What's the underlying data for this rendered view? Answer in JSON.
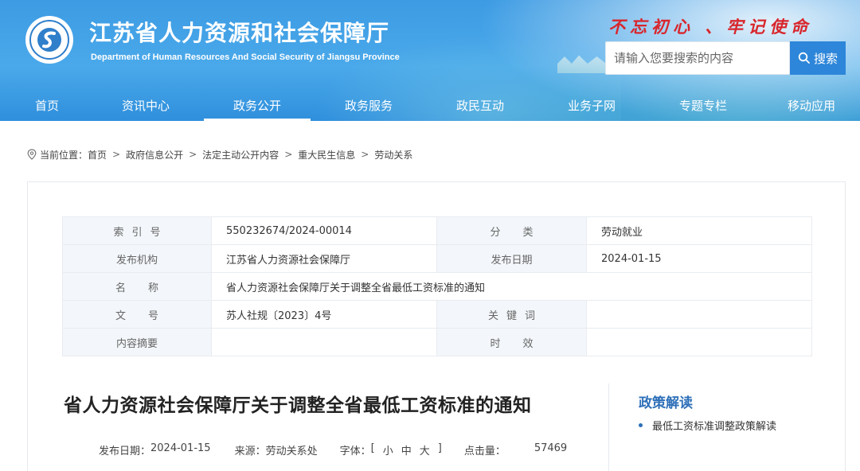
{
  "header": {
    "site_title": "江苏省人力资源和社会保障厅",
    "site_title_en": "Department of Human Resources And Social Security of Jiangsu Province",
    "slogan": "不忘初心 、牢记使命",
    "logo_icon": "jiangsu-hrss-emblem-icon"
  },
  "search": {
    "placeholder": "请输入您要搜索的内容",
    "button_label": "搜索",
    "icon": "search-icon"
  },
  "nav": {
    "items": [
      {
        "label": "首页"
      },
      {
        "label": "资讯中心"
      },
      {
        "label": "政务公开"
      },
      {
        "label": "政务服务"
      },
      {
        "label": "政民互动"
      },
      {
        "label": "业务子网"
      },
      {
        "label": "专题专栏"
      },
      {
        "label": "移动应用"
      }
    ],
    "active": "政务公开"
  },
  "breadcrumb": {
    "prefix": "当前位置：",
    "items": [
      "首页",
      "政府信息公开",
      "法定主动公开内容",
      "重大民生信息",
      "劳动关系"
    ],
    "separator": ">"
  },
  "meta": {
    "index_label": "索引号",
    "index_value": "550232674/2024-00014",
    "category_label": "分类",
    "category_value": "劳动就业",
    "publisher_label": "发布机构",
    "publisher_value": "江苏省人力资源社会保障厅",
    "pubdate_label": "发布日期",
    "pubdate_value": "2024-01-15",
    "name_label": "名称",
    "name_value": "省人力资源社会保障厅关于调整全省最低工资标准的通知",
    "docno_label": "文号",
    "docno_value": "苏人社规〔2023〕4号",
    "keywords_label": "关键词",
    "keywords_value": "",
    "summary_label": "内容摘要",
    "summary_value": "",
    "validity_label": "时效",
    "validity_value": ""
  },
  "article": {
    "title": "省人力资源社会保障厅关于调整全省最低工资标准的通知",
    "date_label": "发布日期：",
    "date_value": "2024-01-15",
    "source_label": "来源：",
    "source_value": "劳动关系处",
    "font_label": "字体：",
    "font_open": "[",
    "font_small": "小",
    "font_medium": "中",
    "font_large": "大",
    "font_close": "]",
    "views_label": "点击量：",
    "views_value": "57469"
  },
  "policy": {
    "title": "政策解读",
    "items": [
      "最低工资标准调整政策解读"
    ]
  },
  "colors": {
    "header_blue": "#3d9be3",
    "slogan_red": "#d8262c",
    "search_button": "#2d86d9",
    "policy_blue": "#2d6fb8"
  }
}
